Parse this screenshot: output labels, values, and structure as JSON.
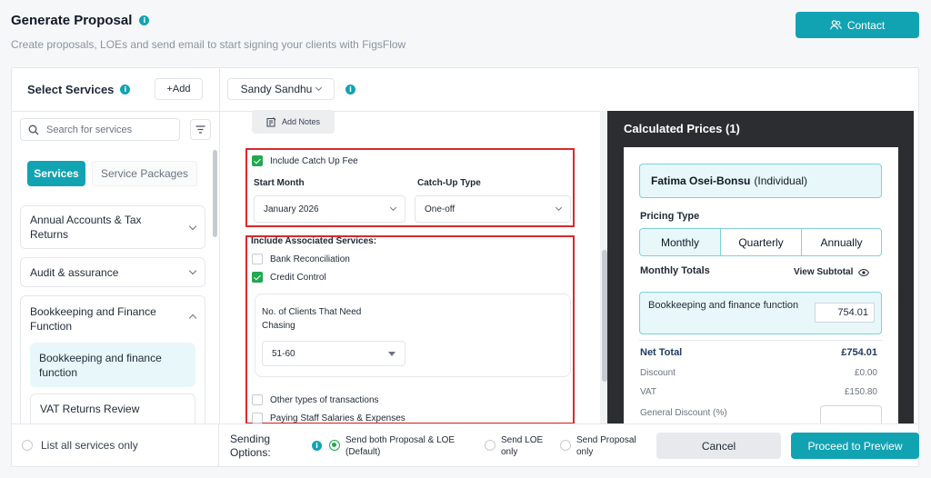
{
  "header": {
    "title": "Generate Proposal",
    "subtitle": "Create proposals, LOEs and send email to start signing your clients with FigsFlow",
    "contact_label": "Contact"
  },
  "services_panel": {
    "title": "Select Services",
    "add_label": "+Add",
    "search_placeholder": "Search for services",
    "tabs": [
      "Services",
      "Service Packages"
    ],
    "categories": [
      {
        "label": "Annual Accounts & Tax Returns",
        "expanded": false
      },
      {
        "label": "Audit & assurance",
        "expanded": false
      },
      {
        "label": "Bookkeeping and Finance Function",
        "expanded": true
      }
    ],
    "sub_items": [
      "Bookkeeping and finance function",
      "VAT Returns Review"
    ],
    "list_all_label": "List all services only"
  },
  "client_select": {
    "value": "Sandy Sandhu"
  },
  "form": {
    "add_notes_label": "Add Notes",
    "catch_up": {
      "label": "Include Catch Up Fee",
      "checked": true,
      "start_month_label": "Start Month",
      "start_month_value": "January 2026",
      "type_label": "Catch-Up Type",
      "type_value": "One-off"
    },
    "associated": {
      "title": "Include Associated Services:",
      "items": [
        {
          "label": "Bank Reconciliation",
          "checked": false
        },
        {
          "label": "Credit Control",
          "checked": true
        }
      ],
      "clients_label": "No. of Clients That Need Chasing",
      "clients_value": "51-60",
      "more_items": [
        {
          "label": "Other types of transactions",
          "checked": false
        },
        {
          "label": "Paying Staff Salaries & Expenses",
          "checked": false
        }
      ]
    }
  },
  "prices": {
    "title": "Calculated Prices (1)",
    "client_name": "Fatima Osei-Bonsu",
    "client_type": "(Individual)",
    "pricing_type_label": "Pricing Type",
    "pricing_options": [
      "Monthly",
      "Quarterly",
      "Annually"
    ],
    "selected_pricing": "Monthly",
    "totals_label": "Monthly Totals",
    "view_subtotal_label": "View Subtotal",
    "line_item_label": "Bookkeeping and finance function",
    "line_item_value": "754.01",
    "net_total_label": "Net Total",
    "net_total_value": "£754.01",
    "discount_label": "Discount",
    "discount_value": "£0.00",
    "vat_label": "VAT",
    "vat_value": "£150.80",
    "general_discount_label": "General Discount (%)"
  },
  "sending": {
    "label": "Sending Options:",
    "options": [
      {
        "label": "Send both Proposal & LOE (Default)",
        "selected": true
      },
      {
        "label": "Send LOE only",
        "selected": false
      },
      {
        "label": "Send Proposal only",
        "selected": false
      }
    ]
  },
  "actions": {
    "cancel_label": "Cancel",
    "preview_label": "Proceed to Preview"
  },
  "colors": {
    "accent": "#12a3b3",
    "highlight": "#d92a2a",
    "checked": "#22a84f"
  }
}
